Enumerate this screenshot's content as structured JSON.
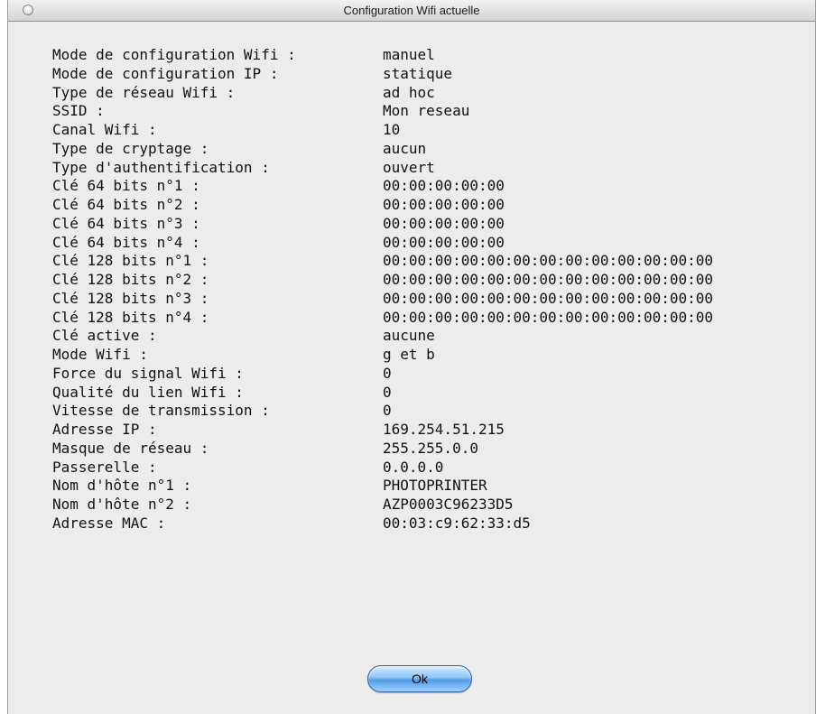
{
  "window": {
    "title": "Configuration Wifi actuelle"
  },
  "config_rows": [
    {
      "label": "Mode de configuration Wifi :",
      "value": "manuel"
    },
    {
      "label": "Mode de configuration IP :",
      "value": "statique"
    },
    {
      "label": "Type de réseau Wifi :",
      "value": "ad hoc"
    },
    {
      "label": "SSID :",
      "value": "Mon reseau"
    },
    {
      "label": "Canal Wifi :",
      "value": "10"
    },
    {
      "label": "Type de cryptage :",
      "value": "aucun"
    },
    {
      "label": "Type d'authentification :",
      "value": "ouvert"
    },
    {
      "label": "Clé 64 bits n°1 :",
      "value": "00:00:00:00:00"
    },
    {
      "label": "Clé 64 bits n°2 :",
      "value": "00:00:00:00:00"
    },
    {
      "label": "Clé 64 bits n°3 :",
      "value": "00:00:00:00:00"
    },
    {
      "label": "Clé 64 bits n°4 :",
      "value": "00:00:00:00:00"
    },
    {
      "label": "Clé 128 bits n°1 :",
      "value": "00:00:00:00:00:00:00:00:00:00:00:00:00"
    },
    {
      "label": "Clé 128 bits n°2 :",
      "value": "00:00:00:00:00:00:00:00:00:00:00:00:00"
    },
    {
      "label": "Clé 128 bits n°3 :",
      "value": "00:00:00:00:00:00:00:00:00:00:00:00:00"
    },
    {
      "label": "Clé 128 bits n°4 :",
      "value": "00:00:00:00:00:00:00:00:00:00:00:00:00"
    },
    {
      "label": "Clé active :",
      "value": "aucune"
    },
    {
      "label": "Mode Wifi :",
      "value": "g et b"
    },
    {
      "label": "Force du signal Wifi :",
      "value": "0"
    },
    {
      "label": "Qualité du lien Wifi :",
      "value": "0"
    },
    {
      "label": "Vitesse de transmission :",
      "value": "0"
    },
    {
      "label": "Adresse IP :",
      "value": "169.254.51.215"
    },
    {
      "label": "Masque de réseau :",
      "value": "255.255.0.0"
    },
    {
      "label": "Passerelle :",
      "value": "0.0.0.0"
    },
    {
      "label": "Nom d'hôte n°1 :",
      "value": "PHOTOPRINTER"
    },
    {
      "label": "Nom d'hôte n°2 :",
      "value": "AZP0003C96233D5"
    },
    {
      "label": "Adresse MAC :",
      "value": "00:03:c9:62:33:d5"
    }
  ],
  "buttons": {
    "ok_label": "Ok"
  }
}
